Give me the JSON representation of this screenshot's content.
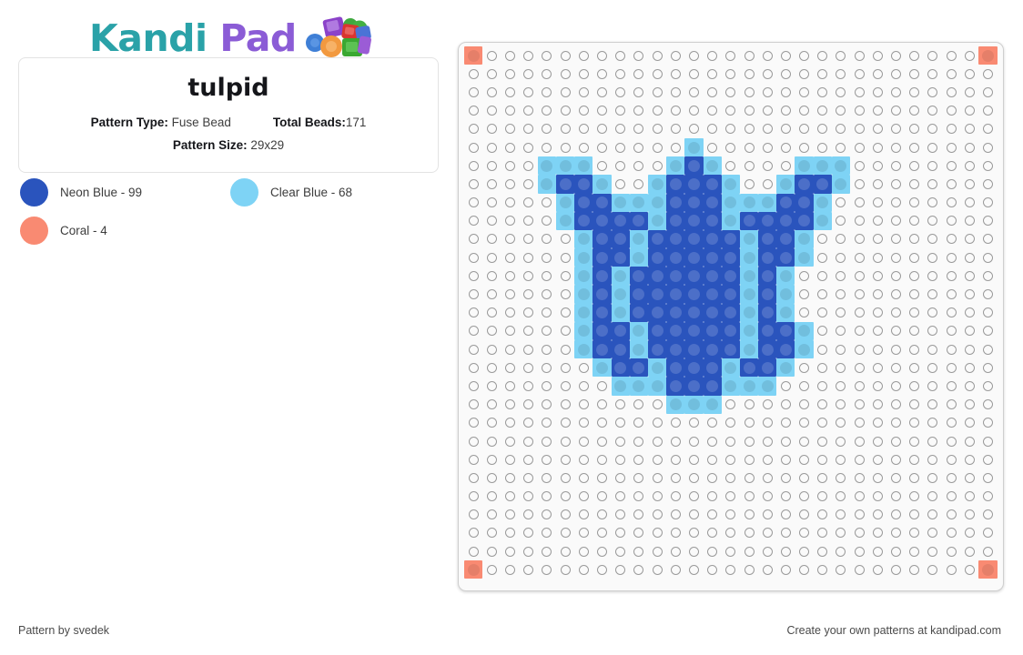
{
  "brand": {
    "name_part1": "Kandi",
    "name_part2": "Pad",
    "color_teal": "#2aa2a8",
    "color_purple": "#8b5cd6",
    "logo_icon": "kandi-beads-icon"
  },
  "pattern": {
    "title": "tulpid",
    "type_label": "Pattern Type:",
    "type_value": "Fuse Bead",
    "total_label": "Total Beads:",
    "total_value": "171",
    "size_label": "Pattern Size:",
    "size_value": "29x29",
    "columns": 29,
    "rows": 29
  },
  "legend": [
    {
      "name": "Neon Blue - 99",
      "color": "#2a54bd",
      "key": "D"
    },
    {
      "name": "Clear Blue - 68",
      "color": "#7ed3f5",
      "key": "L"
    },
    {
      "name": "Coral - 4",
      "color": "#f98a72",
      "key": "C"
    }
  ],
  "palette": {
    "D": "#2a54bd",
    "L": "#7ed3f5",
    "C": "#f98a72",
    "empty": "#fafafa"
  },
  "grid_legend_note": "rows of 29 chars; '.'=empty, D=Neon Blue, L=Clear Blue, C=Coral",
  "grid": [
    "C...........................C",
    ".............................",
    ".............................",
    ".............................",
    ".............................",
    "............L................",
    "....LLL....LDL....LLL........",
    "....LDDL..LDDDL..LDDL........",
    ".....LDDLLLDDDLLLDDL.........",
    ".....LDDDDLDDDLDDDDL.........",
    "......LDDLDDDDDLDDL..........",
    "......LDDLDDDDDLDDL..........",
    "......LDLDDDDDDLDL...........",
    "......LDLDDDDDDLDL...........",
    "......LDLDDDDDDLDL...........",
    "......LDDLDDDDDLDDL..........",
    "......LDDLDDDDDLDDL..........",
    ".......LDDLDDDLDDL...........",
    "........LLLDDDLLL............",
    "...........LLL...............",
    ".............................",
    ".............................",
    ".............................",
    ".............................",
    ".............................",
    ".............................",
    ".............................",
    ".............................",
    "C...........................C"
  ],
  "footer": {
    "left": "Pattern by svedek",
    "right": "Create your own patterns at kandipad.com"
  }
}
